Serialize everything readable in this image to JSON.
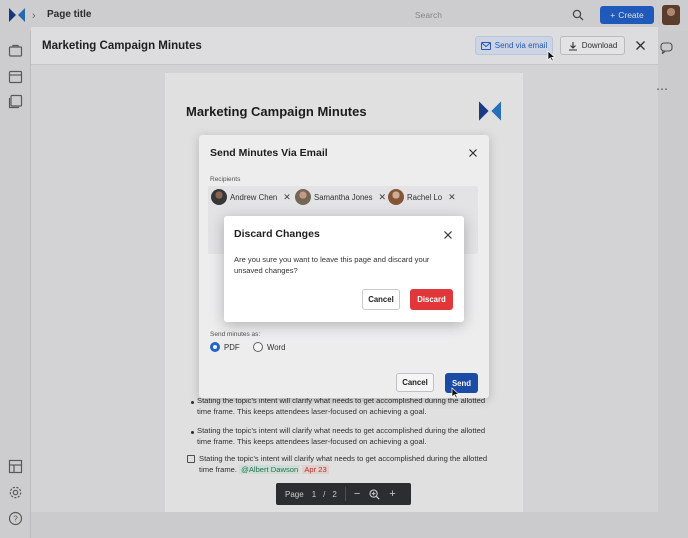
{
  "app": {
    "breadcrumb_chevron": "›",
    "page_title": "Page title",
    "search_placeholder": "Search",
    "create_label": "Create",
    "create_icon": "+"
  },
  "sidebar": {
    "icons": [
      "briefcase-icon",
      "calendar-icon",
      "checklist-icon",
      "dashboard-icon",
      "gear-icon",
      "help-icon"
    ]
  },
  "viewer": {
    "title": "Marketing Campaign Minutes",
    "send_email_label": "Send via email",
    "download_label": "Download"
  },
  "document": {
    "title": "Marketing Campaign Minutes",
    "bullets": [
      "Stating the topic's intent will clarify what needs to get accomplished during the allotted time frame. This keeps attendees laser-focused on achieving a goal.",
      "Stating the topic's intent will clarify what needs to get accomplished during the allotted time frame. This keeps attendees laser-focused on achieving a goal."
    ],
    "task_text": "Stating the topic's intent will clarify what needs to get accomplished during the allotted time frame.",
    "task_mention": "@Albert Dawson",
    "task_date": "Apr 23",
    "pager": {
      "page_label": "Page",
      "current": "1",
      "separator": "/",
      "total": "2",
      "zoom_out": "−",
      "zoom_in": "+"
    }
  },
  "send_modal": {
    "title": "Send Minutes Via Email",
    "recipients_label": "Recipients",
    "recipients": [
      {
        "name": "Andrew Chen"
      },
      {
        "name": "Samantha Jones"
      },
      {
        "name": "Rachel Lo"
      }
    ],
    "send_as_label": "Send minutes as:",
    "formats": [
      {
        "label": "PDF",
        "selected": true
      },
      {
        "label": "Word",
        "selected": false
      }
    ],
    "cancel_label": "Cancel",
    "send_label": "Send"
  },
  "discard_dialog": {
    "title": "Discard Changes",
    "message": "Are you sure you want to leave this page and discard your unsaved changes?",
    "cancel_label": "Cancel",
    "discard_label": "Discard"
  },
  "colors": {
    "primary": "#2566d6",
    "send": "#1e4fad",
    "danger": "#e2373a",
    "brand": "#1c3f8f"
  }
}
